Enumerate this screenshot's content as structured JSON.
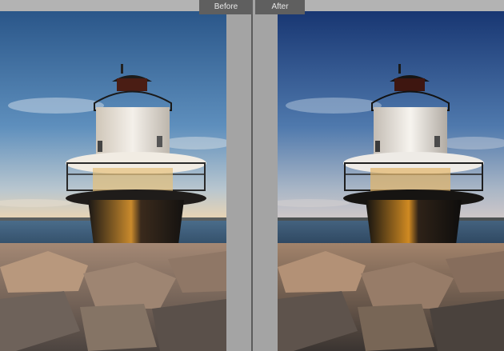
{
  "compare_view": {
    "before_label": "Before",
    "after_label": "After"
  },
  "panes": {
    "before": {
      "sky_top": "#2f5c8f",
      "sky_bottom": "#e9d6bb",
      "sea": "#3f5d7a"
    },
    "after": {
      "sky_top": "#1d3d78",
      "sky_bottom": "#c9c3c9",
      "sea": "#3a536f"
    }
  }
}
